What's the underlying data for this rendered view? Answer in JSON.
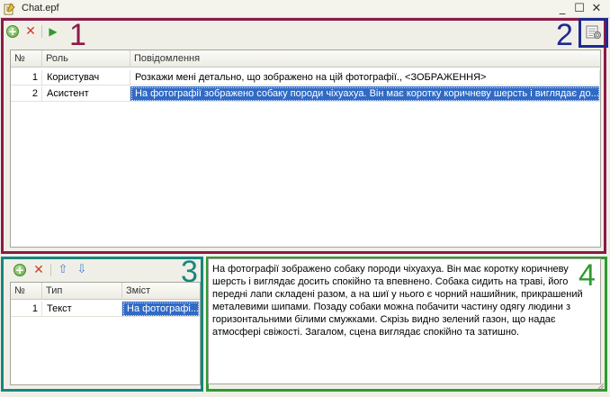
{
  "window": {
    "title": "Chat.epf",
    "minimize": "_",
    "maximize": "☐",
    "close": "✕"
  },
  "section_labels": [
    "1",
    "2",
    "3",
    "4"
  ],
  "colors": {
    "section1": "#8b1a48",
    "section2": "#1e2a8f",
    "section3": "#17867e",
    "section4": "#2e9b2e",
    "selection": "#316ac5"
  },
  "messages_toolbar": {
    "icons": [
      "add-icon",
      "delete-icon",
      "run-icon"
    ]
  },
  "messages_table": {
    "columns": [
      "№",
      "Роль",
      "Повідомлення"
    ],
    "rows": [
      {
        "num": "1",
        "role": "Користувач",
        "message": "Розкажи мені детально, що зображено на цій фотографії., <ЗОБРАЖЕННЯ>"
      },
      {
        "num": "2",
        "role": "Асистент",
        "message": "На фотографії зображено собаку породи чіхуахуа. Він має коротку коричневу шерсть і виглядає до..."
      }
    ]
  },
  "settings": {
    "icon": "settings-icon"
  },
  "content_toolbar": {
    "icons": [
      "add-icon",
      "delete-icon",
      "arrow-up-icon",
      "arrow-down-icon"
    ]
  },
  "content_table": {
    "columns": [
      "№",
      "Тип",
      "Зміст"
    ],
    "rows": [
      {
        "num": "1",
        "type": "Текст",
        "content": "На фотографі..."
      }
    ]
  },
  "response_text": "На фотографії зображено собаку породи чіхуахуа. Він має коротку коричневу шерсть і виглядає досить спокійно та впевнено. Собака сидить на траві, його передні лапи складені разом, а на шиї у нього є чорний нашийник, прикрашений металевими шипами. Позаду собаки можна побачити частину одягу людини з горизонтальними білими смужками. Скрізь видно зелений газон, що надає атмосфері свіжості. Загалом, сцена виглядає спокійно та затишно."
}
